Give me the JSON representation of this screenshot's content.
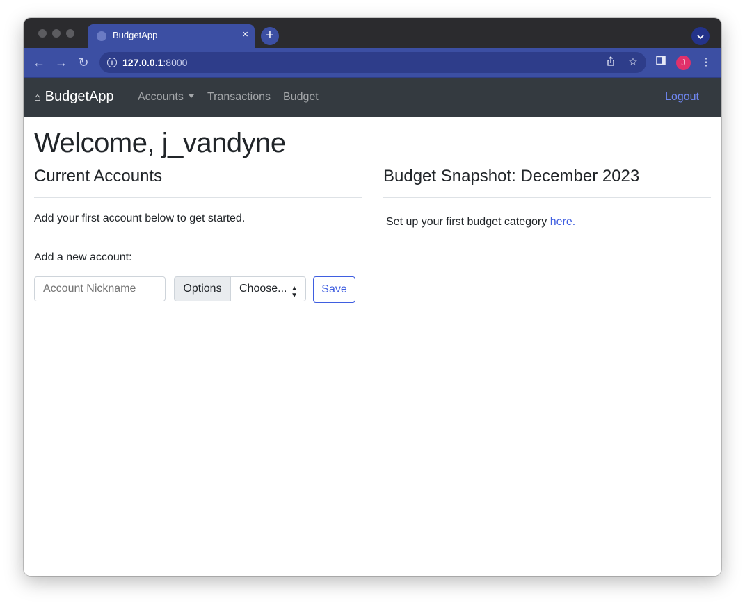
{
  "browser": {
    "tab_title": "BudgetApp",
    "tab_close": "×",
    "new_tab": "+",
    "url_host": "127.0.0.1",
    "url_port": ":8000",
    "profile_initial": "J"
  },
  "navbar": {
    "brand": "BudgetApp",
    "links": {
      "accounts": "Accounts",
      "transactions": "Transactions",
      "budget": "Budget"
    },
    "logout": "Logout"
  },
  "main": {
    "welcome": "Welcome, j_vandyne",
    "accounts": {
      "heading": "Current Accounts",
      "empty_message": "Add your first account below to get started.",
      "add_label": "Add a new account:",
      "nickname_placeholder": "Account Nickname",
      "options_label": "Options",
      "select_value": "Choose...",
      "save_label": "Save"
    },
    "budget": {
      "heading": "Budget Snapshot: December 2023",
      "setup_text": "Set up your first budget category ",
      "setup_link": "here."
    }
  },
  "colors": {
    "accent": "#3f5ee0",
    "navbar": "#343a40",
    "browser_tab": "#3c4fa3",
    "avatar": "#e0316b"
  }
}
